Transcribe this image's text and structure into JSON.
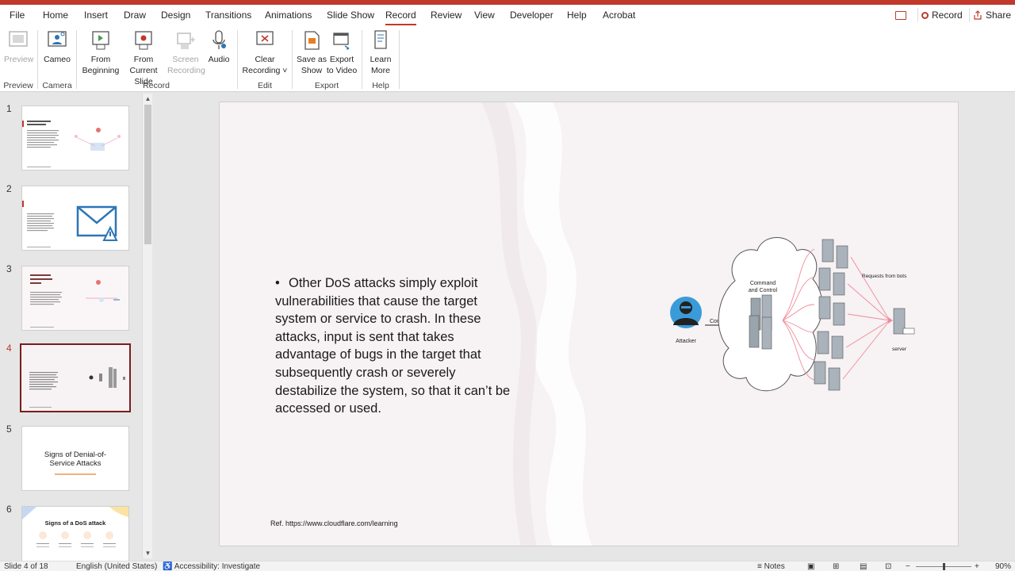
{
  "menu": {
    "tabs": [
      "File",
      "Home",
      "Insert",
      "Draw",
      "Design",
      "Transitions",
      "Animations",
      "Slide Show",
      "Record",
      "Review",
      "View",
      "Developer",
      "Help",
      "Acrobat"
    ],
    "active_tab": "Record",
    "record_label": "Record",
    "share_label": "Share"
  },
  "ribbon": {
    "preview": "Preview",
    "cameo": "Cameo",
    "from_beginning": [
      "From",
      "Beginning"
    ],
    "from_current": [
      "From",
      "Current Slide"
    ],
    "screen_recording": [
      "Screen",
      "Recording"
    ],
    "audio": "Audio",
    "clear_recording": [
      "Clear",
      "Recording ˅"
    ],
    "save_as_show": [
      "Save as",
      "Show"
    ],
    "export_to_video": [
      "Export",
      "to Video"
    ],
    "learn_more": [
      "Learn",
      "More"
    ],
    "groups": {
      "preview": "Preview",
      "camera": "Camera",
      "record": "Record",
      "edit": "Edit",
      "export": "Export",
      "help": "Help"
    }
  },
  "thumbnails": {
    "numbers": [
      "1",
      "2",
      "3",
      "4",
      "5",
      "6"
    ],
    "active_index": 3,
    "slide5_title": "Signs of Denial-of-Service Attacks",
    "slide6_title": "Signs of a DoS attack"
  },
  "slide": {
    "bullet_text": "Other DoS attacks simply exploit vulnerabilities that cause the target system or service to crash. In these attacks, input is sent that takes advantage of bugs in the target that subsequently crash or severely destabilize the system, so that it can’t be accessed or used.",
    "ref_text": "Ref.  https://www.cloudflare.com/learning",
    "diagram": {
      "attacker": "Attacker",
      "command": "Command",
      "cnc_line1": "Command",
      "cnc_line2": "and Control",
      "requests": "Requests from bots",
      "server": "server"
    }
  },
  "statusbar": {
    "slide_of": "Slide 4 of 18",
    "language": "English (United States)",
    "accessibility": "Accessibility: Investigate",
    "notes": "Notes",
    "zoom": "90%"
  },
  "colors": {
    "accent": "#c0392b",
    "active_thumb_border": "#7b1c1c",
    "slide_bg": "#f7f2f4"
  }
}
